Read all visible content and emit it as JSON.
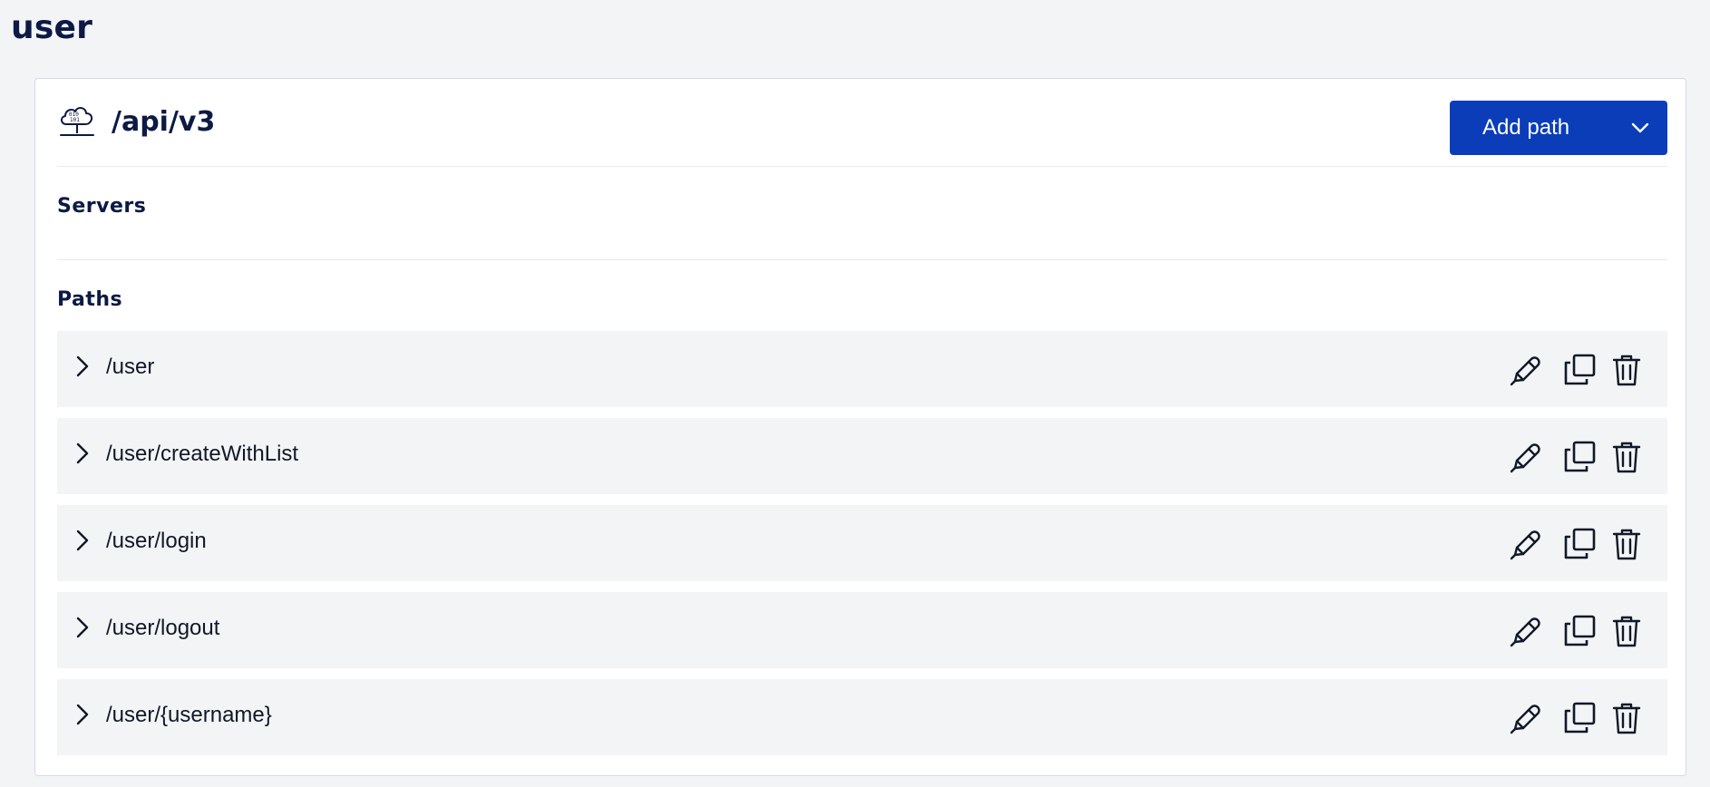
{
  "page": {
    "title": "user"
  },
  "card": {
    "api_title": "/api/v3",
    "add_path_label": "Add path",
    "servers_label": "Servers",
    "paths_label": "Paths"
  },
  "paths": [
    {
      "path": "/user"
    },
    {
      "path": "/user/createWithList"
    },
    {
      "path": "/user/login"
    },
    {
      "path": "/user/logout"
    },
    {
      "path": "/user/{username}"
    }
  ],
  "icons": {
    "server": "server-cloud-icon",
    "caret": "chevron-down-icon",
    "expand": "chevron-right-icon",
    "edit": "pencil-icon",
    "duplicate": "copy-icon",
    "delete": "trash-icon"
  },
  "colors": {
    "primary": "#0b3db8",
    "text": "#0c1a44",
    "row_bg": "#f3f4f6",
    "page_bg": "#f3f4f6"
  }
}
